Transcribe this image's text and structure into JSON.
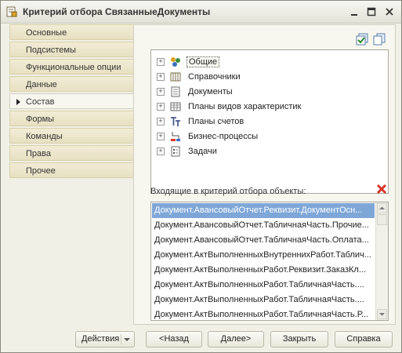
{
  "window": {
    "title": "Критерий отбора СвязанныеДокументы",
    "icons": [
      "filter-doc-icon",
      "minimize-icon",
      "maximize-icon",
      "close-icon"
    ]
  },
  "nav": {
    "items": [
      {
        "label": "Основные"
      },
      {
        "label": "Подсистемы"
      },
      {
        "label": "Функциональные опции"
      },
      {
        "label": "Данные"
      },
      {
        "label": "Состав",
        "active": true
      },
      {
        "label": "Формы"
      },
      {
        "label": "Команды"
      },
      {
        "label": "Права"
      },
      {
        "label": "Прочее"
      }
    ]
  },
  "tree": {
    "items": [
      {
        "label": "Общие",
        "icon": "common-objects-icon",
        "selected": true
      },
      {
        "label": "Справочники",
        "icon": "catalog-icon"
      },
      {
        "label": "Документы",
        "icon": "document-icon"
      },
      {
        "label": "Планы видов характеристик",
        "icon": "chart-of-characteristics-icon"
      },
      {
        "label": "Планы счетов",
        "icon": "chart-of-accounts-icon"
      },
      {
        "label": "Бизнес-процессы",
        "icon": "business-process-icon"
      },
      {
        "label": "Задачи",
        "icon": "task-icon"
      }
    ]
  },
  "objects": {
    "label": "Входящие в критерий отбора объекты:",
    "items": [
      "Документ.АвансовыйОтчет.Реквизит.ДокументОсн...",
      "Документ.АвансовыйОтчет.ТабличнаяЧасть.Прочие...",
      "Документ.АвансовыйОтчет.ТабличнаяЧасть.Оплата...",
      "Документ.АктВыполненныхВнутреннихРабот.Таблич...",
      "Документ.АктВыполненныхРабот.Реквизит.ЗаказКл...",
      "Документ.АктВыполненныхРабот.ТабличнаяЧасть....",
      "Документ.АктВыполненныхРабот.ТабличнаяЧасть....",
      "Документ.АктВыполненныхРабот.ТабличнаяЧасть.Р..."
    ]
  },
  "buttons": {
    "actions": "Действия",
    "back": "<Назад",
    "next": "Далее>",
    "close": "Закрыть",
    "help": "Справка"
  },
  "colors": {
    "selection": "#7ea7d8",
    "nav_tab": "#ece5c8",
    "remove_red": "#d9332a"
  }
}
